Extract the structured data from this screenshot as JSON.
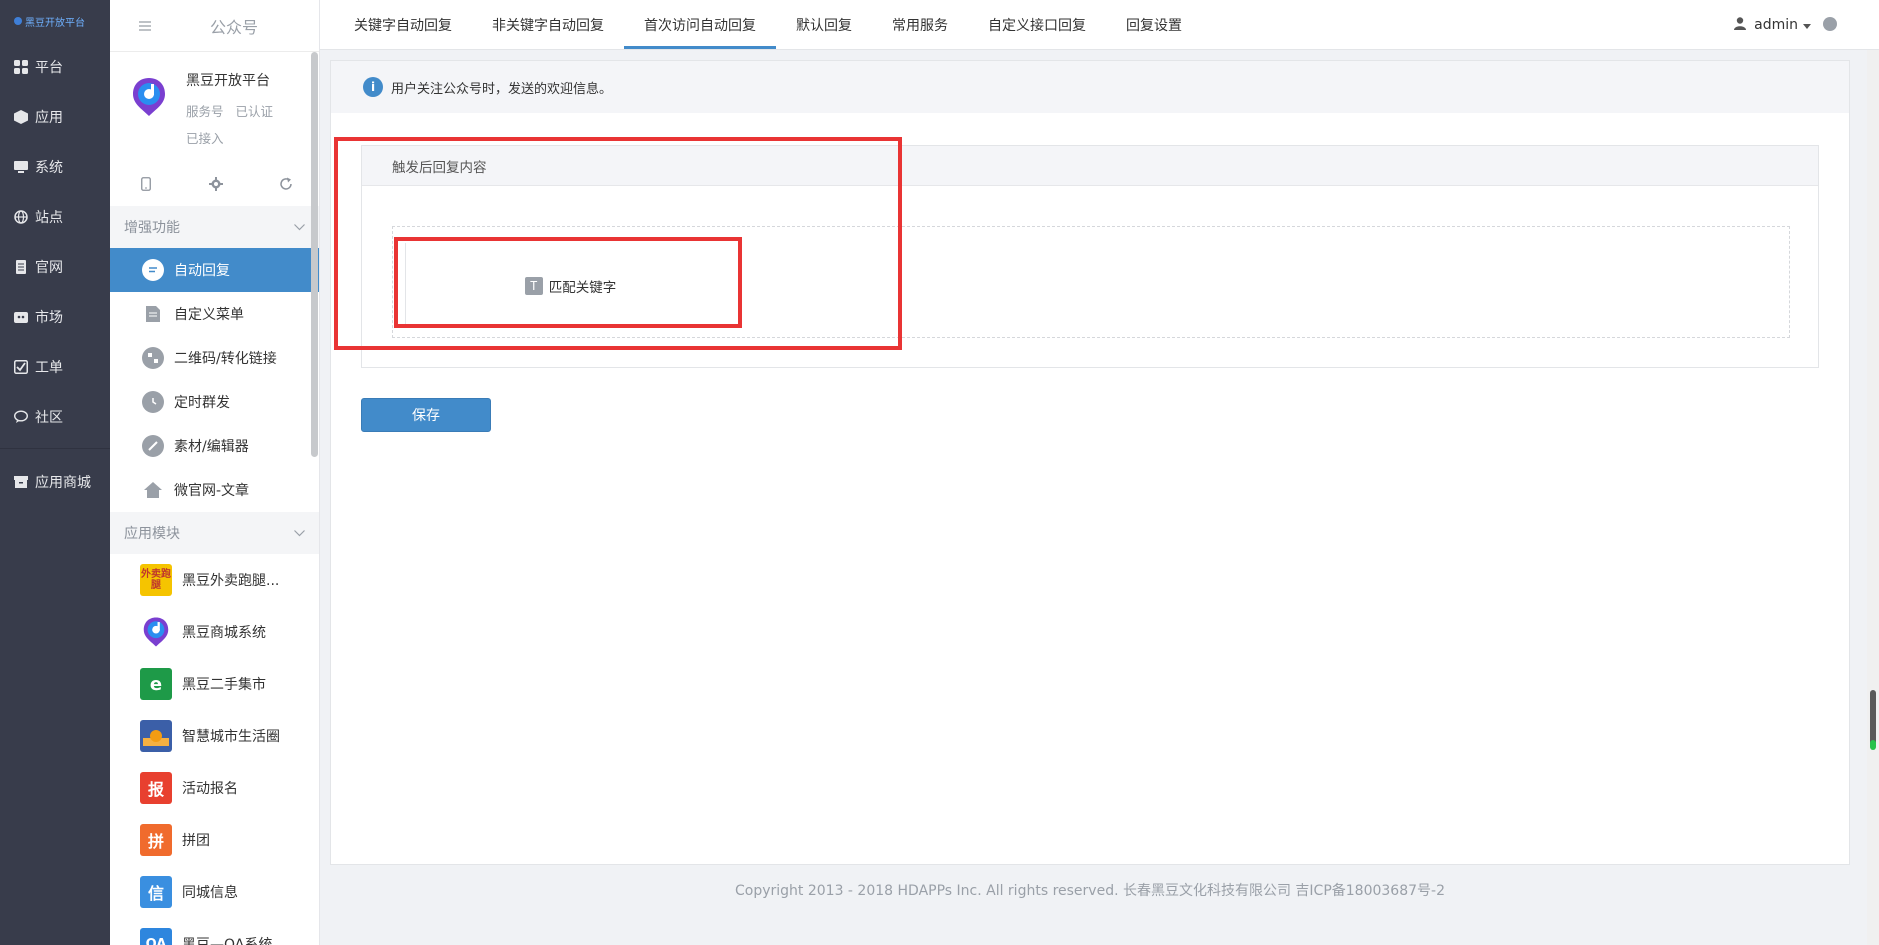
{
  "logo": {
    "text": "黑豆开放平台"
  },
  "leftnav": {
    "items": [
      {
        "label": "平台",
        "icon": "grid-icon"
      },
      {
        "label": "应用",
        "icon": "cube-icon"
      },
      {
        "label": "系统",
        "icon": "monitor-icon"
      },
      {
        "label": "站点",
        "icon": "globe-icon"
      },
      {
        "label": "官网",
        "icon": "document-icon"
      },
      {
        "label": "市场",
        "icon": "store-icon"
      },
      {
        "label": "工单",
        "icon": "checkbox-icon"
      },
      {
        "label": "社区",
        "icon": "chat-icon"
      }
    ],
    "store": {
      "label": "应用商城",
      "icon": "archive-icon"
    }
  },
  "sidebar": {
    "title": "公众号",
    "account": {
      "name": "黑豆开放平台",
      "type": "服务号",
      "status": "已认证",
      "access": "已接入"
    },
    "group1": {
      "label": "增强功能"
    },
    "menu": [
      {
        "label": "自动回复",
        "icon": "chat-bubble-icon"
      },
      {
        "label": "自定义菜单",
        "icon": "edit-doc-icon"
      },
      {
        "label": "二维码/转化链接",
        "icon": "qrcode-icon"
      },
      {
        "label": "定时群发",
        "icon": "clock-icon"
      },
      {
        "label": "素材/编辑器",
        "icon": "pencil-icon"
      },
      {
        "label": "微官网-文章",
        "icon": "home-icon"
      }
    ],
    "group2": {
      "label": "应用模块"
    },
    "apps": [
      {
        "label": "黑豆外卖跑腿...",
        "icon_text": "外卖跑腿",
        "color": "#f5c400"
      },
      {
        "label": "黑豆商城系统",
        "icon_text": "",
        "color": "#ffffff"
      },
      {
        "label": "黑豆二手集市",
        "icon_text": "e",
        "color": "#1e9a48"
      },
      {
        "label": "智慧城市生活圈",
        "icon_text": "",
        "color": "#3b5fa8"
      },
      {
        "label": "活动报名",
        "icon_text": "报",
        "color": "#e8402f"
      },
      {
        "label": "拼团",
        "icon_text": "拼",
        "color": "#f06b2d"
      },
      {
        "label": "同城信息",
        "icon_text": "信",
        "color": "#3a8fe0"
      },
      {
        "label": "黑豆—OA系统",
        "icon_text": "OA",
        "color": "#2e86de"
      }
    ]
  },
  "topbar": {
    "tabs": [
      "关键字自动回复",
      "非关键字自动回复",
      "首次访问自动回复",
      "默认回复",
      "常用服务",
      "自定义接口回复",
      "回复设置"
    ],
    "active_tab": 2,
    "user": "admin"
  },
  "main": {
    "notice": "用户关注公众号时，发送的欢迎信息。",
    "panel_title": "触发后回复内容",
    "keyword_button": "匹配关键字",
    "save_label": "保存"
  },
  "footer": {
    "text": "Copyright 2013 - 2018 HDAPPs Inc. All rights reserved. 长春黑豆文化科技有限公司 吉ICP备18003687号-2"
  }
}
